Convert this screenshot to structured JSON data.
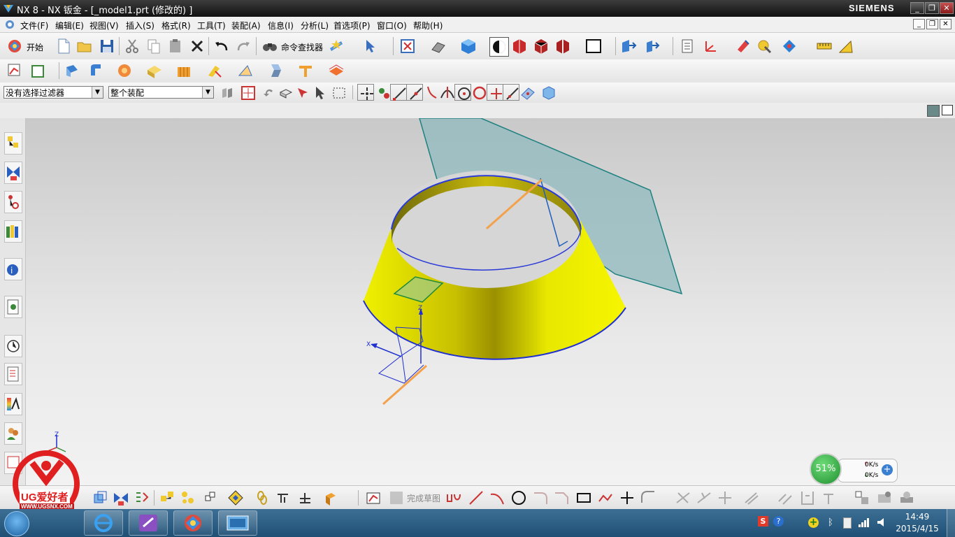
{
  "window": {
    "title": "NX 8 - NX 钣金 - [_model1.prt  (修改的) ]",
    "brand": "SIEMENS",
    "minimize": "_",
    "restore": "❐",
    "close": "✕"
  },
  "menubar": {
    "items": [
      "文件(F)",
      "编辑(E)",
      "视图(V)",
      "插入(S)",
      "格式(R)",
      "工具(T)",
      "装配(A)",
      "信息(I)",
      "分析(L)",
      "首选项(P)",
      "窗口(O)",
      "帮助(H)"
    ]
  },
  "toolbar_main": {
    "start_label": "开始",
    "command_finder_label": "命令查找器"
  },
  "selection_bar": {
    "filter_value": "没有选择过滤器",
    "scope_value": "整个装配"
  },
  "sketch_bar": {
    "finish_sketch_label": "完成草图"
  },
  "viewport": {
    "triad_x": "X",
    "triad_z": "Z",
    "corner_triad_z": "Z",
    "colors": {
      "cone_fill": "#f0f000",
      "edge": "#1f2fd0",
      "plane": "#8fb9bd",
      "axis": "#f3a24b"
    }
  },
  "net_widget": {
    "percent": "51%",
    "up_speed": "0K/s",
    "down_speed": "0K/s"
  },
  "watermark": {
    "text": "UG爱好者",
    "url": "WWW.UGSNX.COM"
  },
  "taskbar": {
    "time": "14:49",
    "date": "2015/4/15"
  }
}
